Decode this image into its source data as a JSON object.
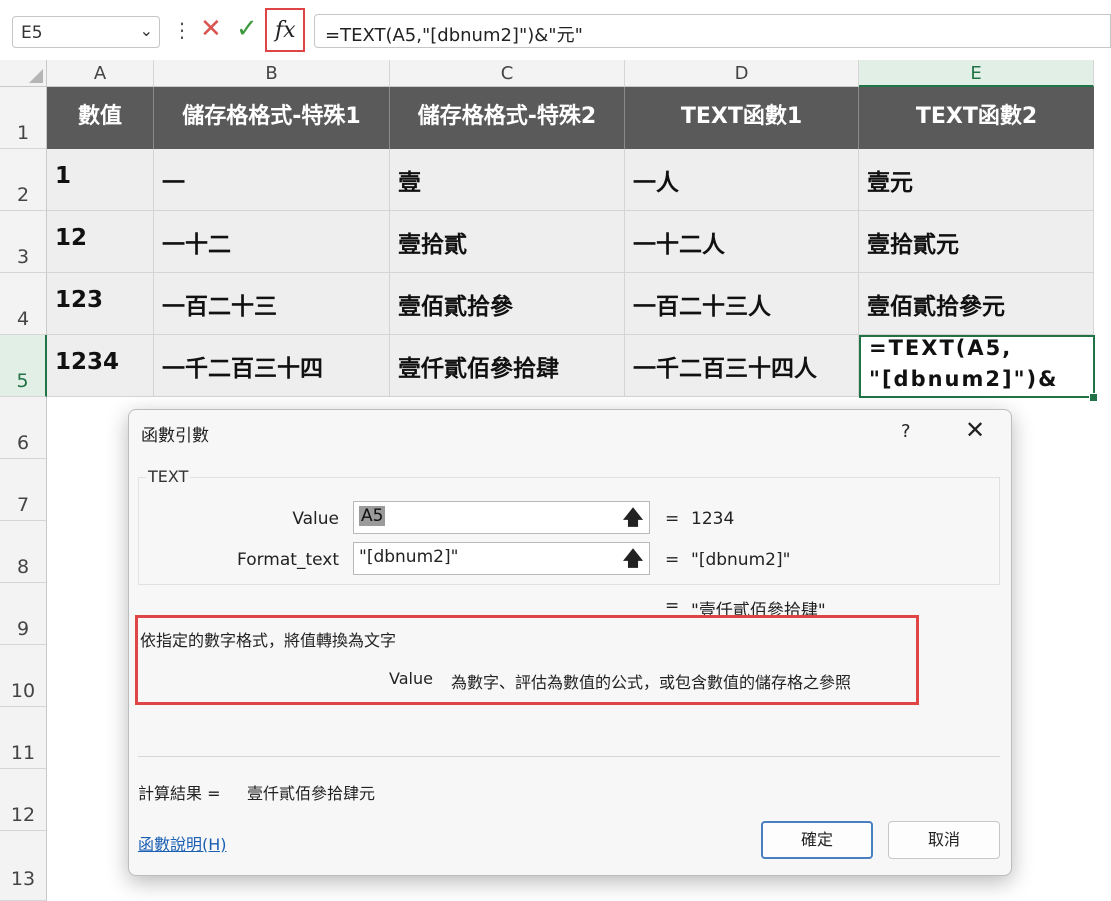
{
  "formula_bar": {
    "name_box": "E5",
    "fx_label": "fx",
    "formula": "=TEXT(A5,\"[dbnum2]\")&\"元\""
  },
  "columns": [
    "A",
    "B",
    "C",
    "D",
    "E"
  ],
  "rows": [
    "1",
    "2",
    "3",
    "4",
    "5",
    "6",
    "7",
    "8",
    "9",
    "10",
    "11",
    "12",
    "13"
  ],
  "sheet": {
    "headers": [
      "數值",
      "儲存格格式-特殊1",
      "儲存格格式-特殊2",
      "TEXT函數1",
      "TEXT函數2"
    ],
    "data": [
      [
        "1",
        "一",
        "壹",
        "一人",
        "壹元"
      ],
      [
        "12",
        "一十二",
        "壹拾貳",
        "一十二人",
        "壹拾貳元"
      ],
      [
        "123",
        "一百二十三",
        "壹佰貳拾參",
        "一百二十三人",
        "壹佰貳拾參元"
      ],
      [
        "1234",
        "一千二百三十四",
        "壹仟貳佰參拾肆",
        "一千二百三十四人",
        "=TEXT(A5,\n\"[dbnum2]\")&"
      ]
    ]
  },
  "dialog": {
    "title": "函數引數",
    "help_icon": "?",
    "close_icon": "✕",
    "function_name": "TEXT",
    "args": [
      {
        "label": "Value",
        "value": "A5",
        "result": "1234"
      },
      {
        "label": "Format_text",
        "value": "\"[dbnum2]\"",
        "result": "\"[dbnum2]\""
      }
    ],
    "equals": "=",
    "overall_result": "\"壹仟貳佰參拾肆\"",
    "description": "依指定的數字格式，將值轉換為文字",
    "arg_help_name": "Value",
    "arg_help_text": "為數字、評估為數值的公式，或包含數值的儲存格之參照",
    "calc_label": "計算結果 =",
    "calc_value": "壹仟貳佰參拾肆元",
    "help_link": "函數說明(H)",
    "ok_label": "確定",
    "cancel_label": "取消"
  },
  "colors": {
    "header_fill": "#5a5a5a",
    "cell_fill": "#eeeeee",
    "selection": "#217346",
    "highlight_box": "#e04545"
  }
}
